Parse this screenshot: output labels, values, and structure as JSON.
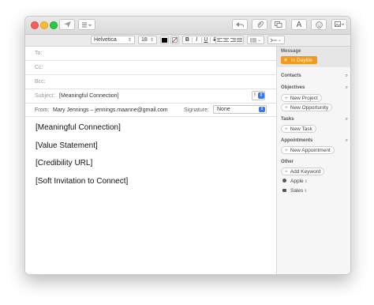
{
  "toolbar": {
    "send_icon": "send-icon",
    "header_fields_icon": "list-icon",
    "reply_icon": "undo-icon",
    "attach_icon": "paperclip-icon",
    "browser_icon": "photo-browser-icon",
    "font_button": "A",
    "emoji_icon": "smiley-icon",
    "photo_icon": "image-icon"
  },
  "format": {
    "font": "Helvetica",
    "size": "18",
    "bold": "B",
    "italic": "I",
    "underline": "U",
    "strike": "S"
  },
  "header": {
    "to_label": "To:",
    "cc_label": "Cc:",
    "bcc_label": "Bcc:",
    "subject_label": "Subject:",
    "subject_value": "[Meaningful Connection]",
    "from_label": "From:",
    "from_value": "Mary Jennings – jennings.maanne@gmail.com",
    "signature_label": "Signature:",
    "signature_value": "None"
  },
  "body": {
    "lines": [
      "[Meaningful Connection]",
      "[Value Statement]",
      "[Credibility URL]",
      "[Soft Invitation to Connect]"
    ]
  },
  "sidebar": {
    "message_label": "Message",
    "daylite_button": "In Daylite",
    "contacts_label": "Contacts",
    "objectives_label": "Objectives",
    "new_project": "New Project",
    "new_opportunity": "New Opportunity",
    "tasks_label": "Tasks",
    "new_task": "New Task",
    "appointments_label": "Appointments",
    "new_appointment": "New Appointment",
    "other_label": "Other",
    "add_keyword": "Add Keyword",
    "apple": "Apple",
    "sales": "Sales"
  },
  "colors": {
    "accent_blue": "#3478f6",
    "daylite_orange": "#f39a1e"
  }
}
